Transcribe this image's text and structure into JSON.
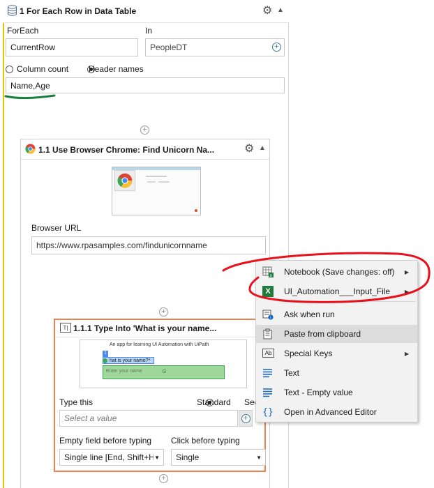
{
  "foreach_activity": {
    "title": "1  For Each Row in Data Table",
    "foreach_label": "ForEach",
    "foreach_value": "CurrentRow",
    "in_label": "In",
    "in_value": "PeopleDT",
    "radio_column_count": "Column count",
    "radio_header_names": "Header names",
    "headers_value": "Name,Age"
  },
  "browser_activity": {
    "title": "1.1  Use Browser Chrome: Find Unicorn Na...",
    "url_label": "Browser URL",
    "url_value": "https://www.rpasamples.com/findunicornname"
  },
  "type_into_activity": {
    "title": "1.1.1  Type Into 'What is your name...",
    "preview_heading": "An app for learning UI Automation with UiPath",
    "preview_tag_badge": "1",
    "preview_label": "hat is your name?*",
    "preview_placeholder": "Enter your name",
    "type_this_label": "Type this",
    "radio_standard": "Standard",
    "radio_secure": "Sec",
    "value_placeholder": "Select a value",
    "empty_field_label": "Empty field before typing",
    "empty_field_value": "Single line [End, Shift+H",
    "click_before_label": "Click before typing",
    "click_before_value": "Single"
  },
  "context_menu": {
    "items": [
      {
        "label": "Notebook (Save changes: off)",
        "icon": "excel-notebook-icon",
        "submenu": true
      },
      {
        "label": "UI_Automation___Input_File",
        "icon": "excel-icon",
        "submenu": true
      },
      {
        "label": "Ask when run",
        "icon": "ask-when-run-icon",
        "submenu": false
      },
      {
        "label": "Paste from clipboard",
        "icon": "clipboard-icon",
        "submenu": false
      },
      {
        "label": "Special Keys",
        "icon": "special-keys-icon",
        "submenu": true
      },
      {
        "label": "Text",
        "icon": "text-icon",
        "submenu": false
      },
      {
        "label": "Text - Empty value",
        "icon": "text-empty-icon",
        "submenu": false
      },
      {
        "label": "Open in Advanced Editor",
        "icon": "braces-icon",
        "submenu": false
      }
    ],
    "highlighted": "Paste from clipboard"
  },
  "colors": {
    "highlight_green": "#1a7f3c",
    "annotation_red": "#e8101a",
    "type_into_border": "#f08050",
    "foreach_accent": "#e8c200"
  }
}
